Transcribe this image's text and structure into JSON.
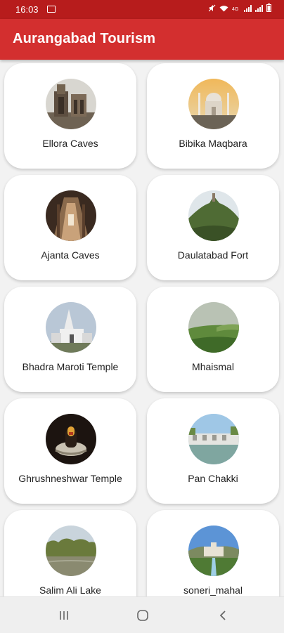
{
  "status_bar": {
    "time": "16:03"
  },
  "app_bar": {
    "title": "Aurangabad Tourism",
    "color": "#d32f2f"
  },
  "places": [
    {
      "name": "Ellora Caves",
      "icon": "ellora-caves-photo"
    },
    {
      "name": "Bibika Maqbara",
      "icon": "bibika-maqbara-photo"
    },
    {
      "name": "Ajanta Caves",
      "icon": "ajanta-caves-photo"
    },
    {
      "name": "Daulatabad Fort",
      "icon": "daulatabad-fort-photo"
    },
    {
      "name": "Bhadra Maroti Temple",
      "icon": "bhadra-maroti-temple-photo"
    },
    {
      "name": "Mhaismal",
      "icon": "mhaismal-photo"
    },
    {
      "name": "Ghrushneshwar Temple",
      "icon": "ghrushneshwar-temple-photo"
    },
    {
      "name": "Pan Chakki",
      "icon": "pan-chakki-photo"
    },
    {
      "name": "Salim Ali Lake",
      "icon": "salim-ali-lake-photo"
    },
    {
      "name": "soneri_mahal",
      "icon": "soneri-mahal-photo"
    }
  ],
  "nav_bar": {
    "buttons": [
      "recent-apps-icon",
      "home-icon",
      "back-icon"
    ]
  }
}
